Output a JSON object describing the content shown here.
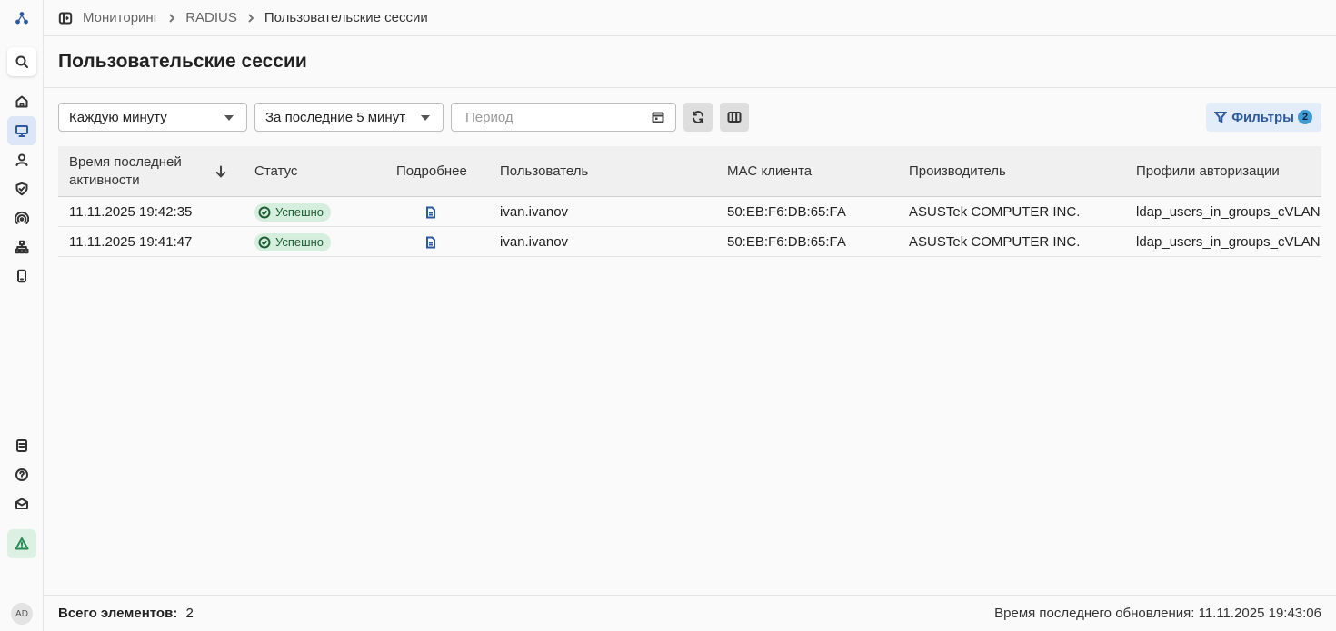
{
  "breadcrumb": [
    "Мониторинг",
    "RADIUS",
    "Пользовательские сессии"
  ],
  "page": {
    "title": "Пользовательские сессии"
  },
  "toolbar": {
    "refresh_interval": "Каждую минуту",
    "time_range": "За последние 5 минут",
    "period_placeholder": "Период",
    "filters_label": "Фильтры",
    "filters_count": "2"
  },
  "table": {
    "columns": {
      "last_activity": "Время последней активности",
      "status": "Статус",
      "details": "Подробнее",
      "user": "Пользователь",
      "mac": "MAC клиента",
      "vendor": "Производитель",
      "profiles": "Профили авторизации"
    },
    "rows": [
      {
        "time": "11.11.2025 19:42:35",
        "status": "Успешно",
        "user": "ivan.ivanov",
        "mac": "50:EB:F6:DB:65:FA",
        "vendor": "ASUSTek COMPUTER INC.",
        "profile": "ldap_users_in_groups_cVLAN"
      },
      {
        "time": "11.11.2025 19:41:47",
        "status": "Успешно",
        "user": "ivan.ivanov",
        "mac": "50:EB:F6:DB:65:FA",
        "vendor": "ASUSTek COMPUTER INC.",
        "profile": "ldap_users_in_groups_cVLAN"
      }
    ]
  },
  "footer": {
    "total_label": "Всего элементов:",
    "total_value": "2",
    "updated": "Время последнего обновления: 11.11.2025 19:43:06"
  },
  "user": {
    "initials": "AD"
  },
  "colors": {
    "accent": "#2c5aa0",
    "success_bg": "#d5eedd",
    "success_text": "#1f5e34"
  }
}
